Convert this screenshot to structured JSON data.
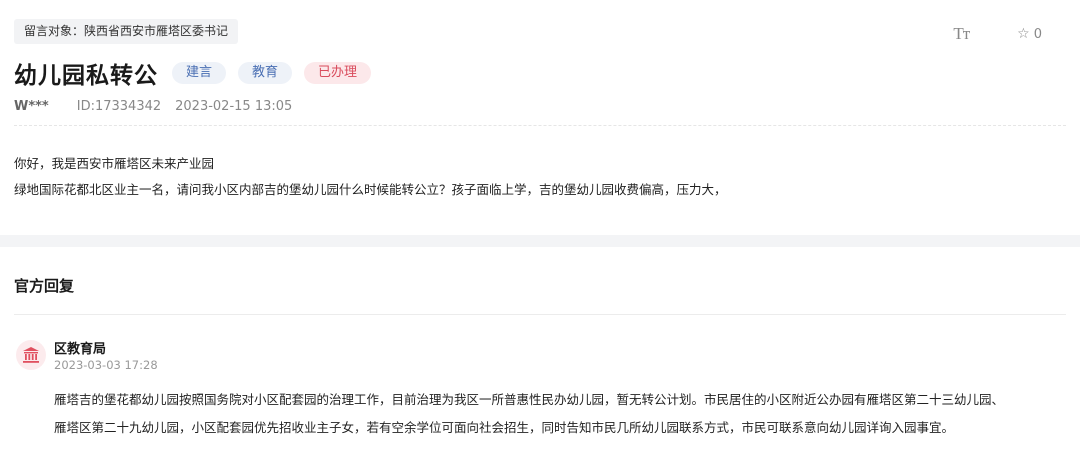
{
  "header": {
    "target_label": "留言对象：陕西省西安市雁塔区委书记",
    "font_tool_label": "Tт",
    "favorite_icon": "star-icon",
    "favorite_count": "0"
  },
  "message": {
    "title": "幼儿园私转公",
    "tags": [
      {
        "label": "建言",
        "color": "#4a6fb3"
      },
      {
        "label": "教育",
        "color": "#4a6fb3"
      },
      {
        "label": "已办理",
        "color": "#d94b5c"
      }
    ],
    "user": "W***",
    "id": "ID:17334342",
    "datetime": "2023-02-15 13:05",
    "body_lines": [
      "你好，我是西安市雁塔区未来产业园",
      "绿地国际花都北区业主一名，请问我小区内部吉的堡幼儿园什么时候能转公立？孩子面临上学，吉的堡幼儿园收费偏高，压力大，"
    ]
  },
  "reply": {
    "heading": "官方回复",
    "org_icon": "government-building-icon",
    "org_name": "区教育局",
    "time": "2023-03-03 17:28",
    "lines": [
      "雁塔吉的堡花都幼儿园按照国务院对小区配套园的治理工作，目前治理为我区一所普惠性民办幼儿园，暂无转公计划。市民居住的小区附近公办园有雁塔区第二十三幼儿园、",
      "雁塔区第二十九幼儿园，小区配套园优先招收业主子女，若有空余学位可面向社会招生，同时告知市民几所幼儿园联系方式，市民可联系意向幼儿园详询入园事宜。"
    ]
  }
}
